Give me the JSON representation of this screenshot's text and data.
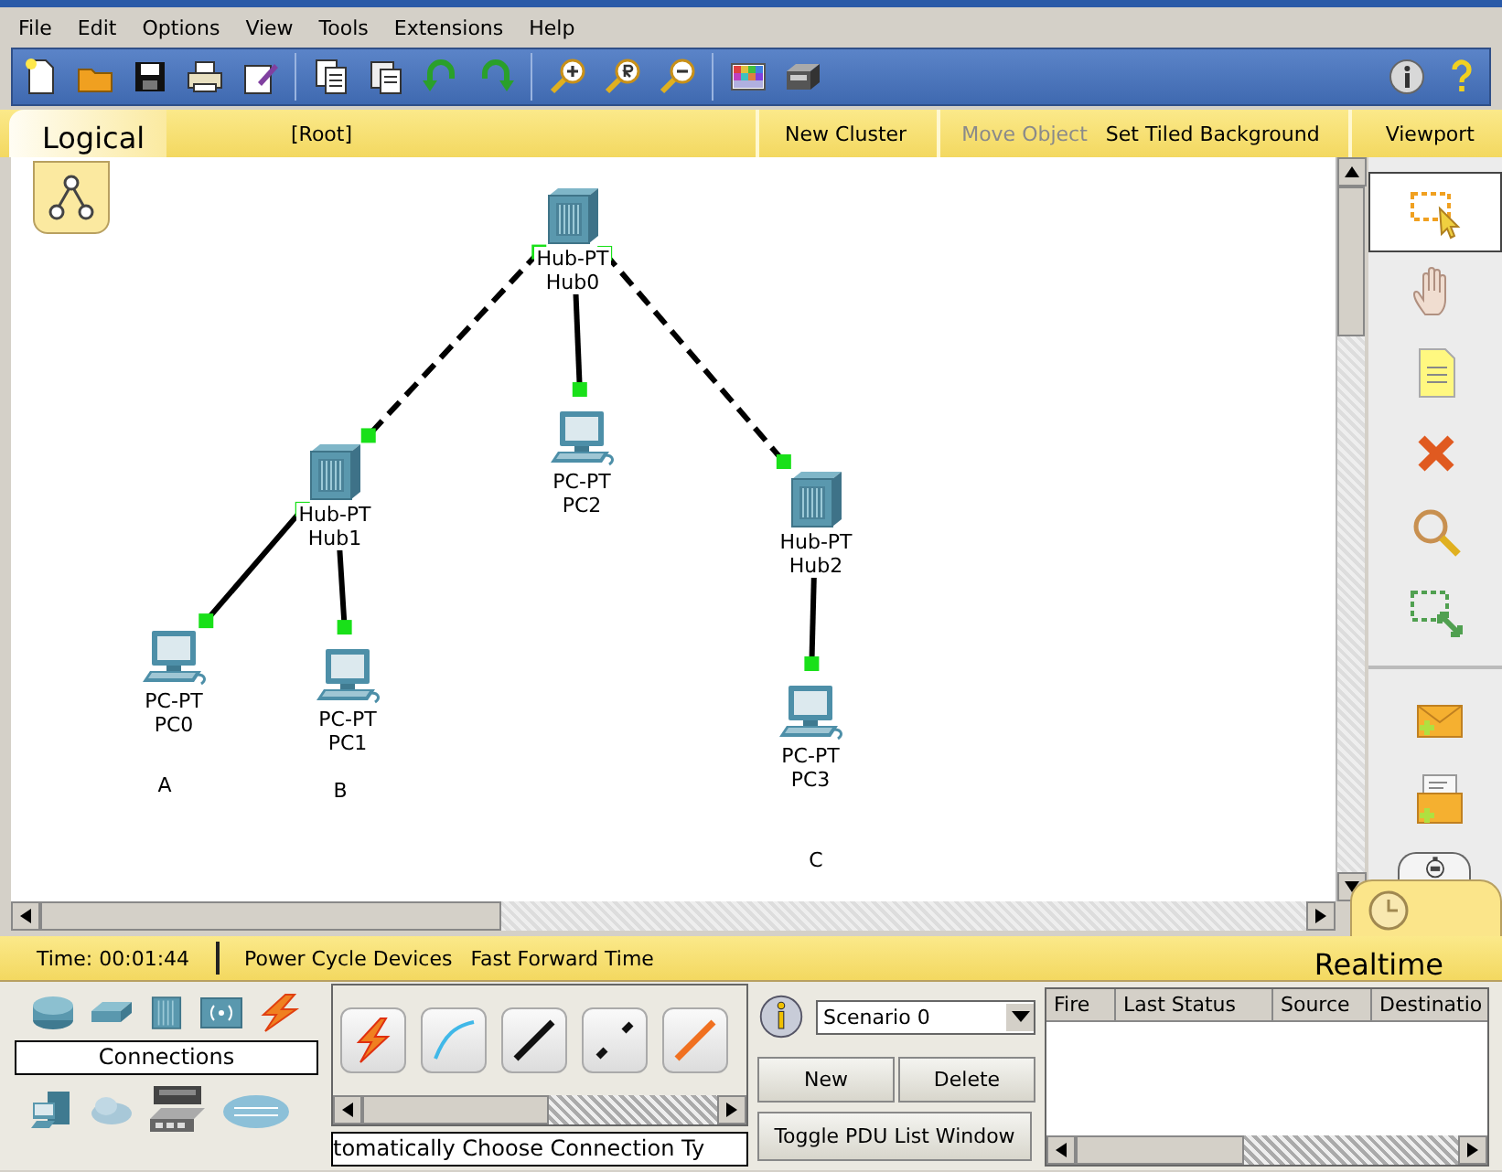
{
  "menu": [
    "File",
    "Edit",
    "Options",
    "View",
    "Tools",
    "Extensions",
    "Help"
  ],
  "workspace_bar": {
    "mode": "Logical",
    "path": "[Root]",
    "actions": [
      {
        "label": "New Cluster",
        "disabled": false
      },
      {
        "label": "Move Object",
        "disabled": true
      },
      {
        "label": "Set Tiled Background",
        "disabled": false
      },
      {
        "label": "Viewport",
        "disabled": false
      }
    ]
  },
  "devices": [
    {
      "kind": "hub",
      "model": "Hub-PT",
      "name": "Hub0"
    },
    {
      "kind": "hub",
      "model": "Hub-PT",
      "name": "Hub1"
    },
    {
      "kind": "pc",
      "model": "PC-PT",
      "name": "PC2"
    },
    {
      "kind": "hub",
      "model": "Hub-PT",
      "name": "Hub2"
    },
    {
      "kind": "pc",
      "model": "PC-PT",
      "name": "PC0"
    },
    {
      "kind": "pc",
      "model": "PC-PT",
      "name": "PC1"
    },
    {
      "kind": "pc",
      "model": "PC-PT",
      "name": "PC3"
    }
  ],
  "links": [
    {
      "kind": "crossover"
    },
    {
      "kind": "straight"
    },
    {
      "kind": "crossover"
    },
    {
      "kind": "straight"
    },
    {
      "kind": "straight"
    },
    {
      "kind": "straight"
    }
  ],
  "notes": [
    "A",
    "B",
    "C"
  ],
  "tools": [
    {
      "kind": "select",
      "selected": true
    },
    {
      "kind": "move",
      "selected": false
    },
    {
      "kind": "note",
      "selected": false
    },
    {
      "kind": "delete",
      "selected": false
    },
    {
      "kind": "inspect",
      "selected": false
    },
    {
      "kind": "resize",
      "selected": false
    },
    {
      "kind": "simple_pdu",
      "selected": false
    },
    {
      "kind": "complex_pdu",
      "selected": false
    }
  ],
  "status_bar": {
    "time": "Time: 00:01:44",
    "actions": [
      "Power Cycle Devices",
      "Fast Forward Time"
    ],
    "mode": "Realtime"
  },
  "device_panel": {
    "category": "Connections",
    "caption": "tomatically Choose Connection Ty"
  },
  "connection_types": [
    {
      "kind": "auto"
    },
    {
      "kind": "console"
    },
    {
      "kind": "straight"
    },
    {
      "kind": "crossover"
    },
    {
      "kind": "fiber"
    }
  ],
  "scenario": {
    "value": "Scenario 0",
    "buttons": [
      "New",
      "Delete"
    ],
    "toggle": "Toggle PDU List Window"
  },
  "pdu_table": {
    "columns": [
      "Fire",
      "Last Status",
      "Source",
      "Destinatio"
    ]
  }
}
